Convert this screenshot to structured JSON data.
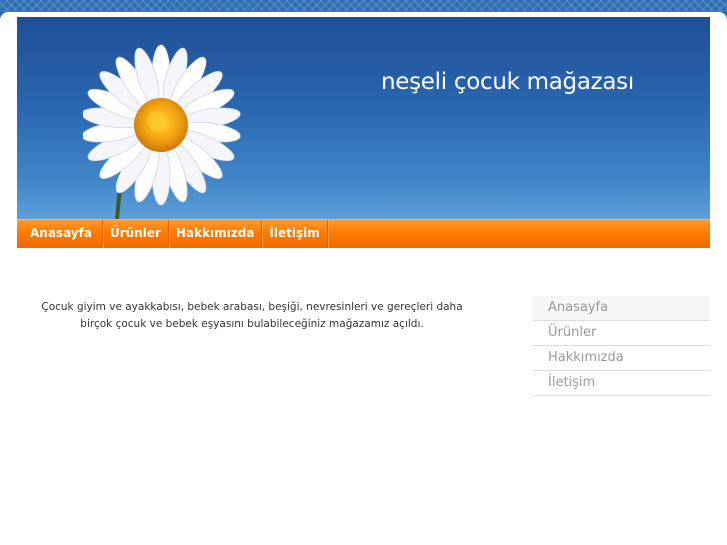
{
  "header": {
    "title": "neşeli çocuk mağazası"
  },
  "nav": {
    "items": [
      {
        "label": "Anasayfa"
      },
      {
        "label": "Ürünler"
      },
      {
        "label": "Hakkımızda"
      },
      {
        "label": "İletişim"
      }
    ]
  },
  "main": {
    "intro_text": "Çocuk giyim ve ayakkabısı, bebek arabası, beşiği, nevresinleri ve gereçleri daha birçok çocuk ve bebek eşyasını bulabileceğiniz mağazamız açıldı."
  },
  "sidebar": {
    "items": [
      {
        "label": "Anasayfa"
      },
      {
        "label": "Ürünler"
      },
      {
        "label": "Hakkımızda"
      },
      {
        "label": "İletişim"
      }
    ]
  },
  "colors": {
    "header_blue": "#2a67b0",
    "nav_orange": "#ff7a00",
    "petal_white": "#ffffff",
    "flower_center": "#f2a20f"
  },
  "icons": {
    "header_image": "daisy-flower-icon"
  }
}
